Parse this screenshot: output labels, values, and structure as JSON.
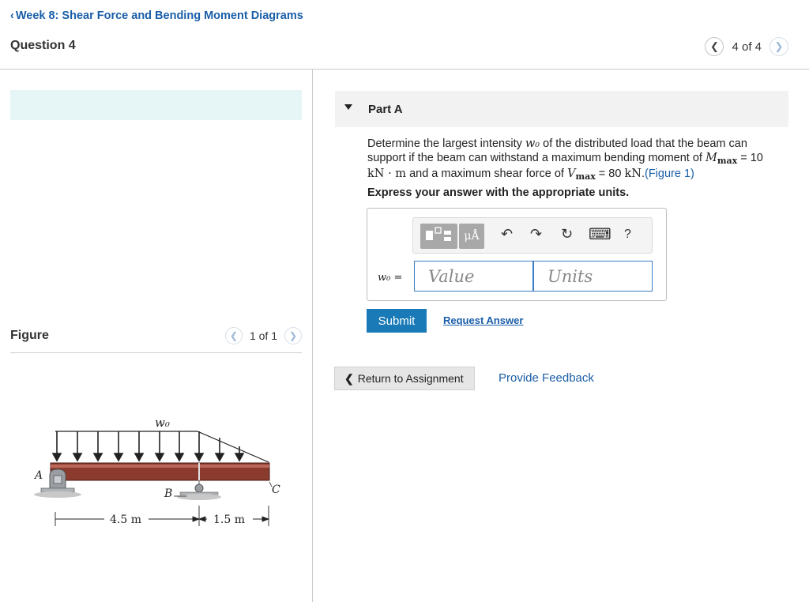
{
  "header": {
    "back_link": "Week 8: Shear Force and Bending Moment Diagrams",
    "question_title": "Question 4",
    "pager_text": "4 of 4"
  },
  "figure": {
    "label": "Figure",
    "pager_text": "1 of 1",
    "labels": {
      "load": "w₀",
      "A": "A",
      "B": "B",
      "C": "C",
      "dim_ab": "4.5 m",
      "dim_bc": "1.5 m"
    }
  },
  "part": {
    "title": "Part A",
    "problem_1": "Determine the largest intensity ",
    "w0": "w₀",
    "problem_2": " of the distributed load that the beam can support if the beam can withstand a maximum bending moment of ",
    "mmax_sym": "M",
    "mmax_sub": "max",
    "problem_3": " = 10 ",
    "kn_m": "kN · m",
    "problem_4": " and a maximum shear force of ",
    "vmax_sym": "V",
    "vmax_sub": "max",
    "problem_5": " = 80 ",
    "kn": "kN",
    "problem_6": ".",
    "figure_link": "(Figure 1)",
    "instruction": "Express your answer with the appropriate units."
  },
  "answer": {
    "variable_label": "w₀ =",
    "value_placeholder": "Value",
    "units_placeholder": "Units",
    "toolbar": {
      "units_block": "μÅ",
      "undo": "↶",
      "redo": "↷",
      "reset": "↻",
      "keyboard": "⌨",
      "help": "?"
    }
  },
  "actions": {
    "submit": "Submit",
    "request_answer": "Request Answer",
    "return": "Return to Assignment",
    "feedback": "Provide Feedback"
  }
}
